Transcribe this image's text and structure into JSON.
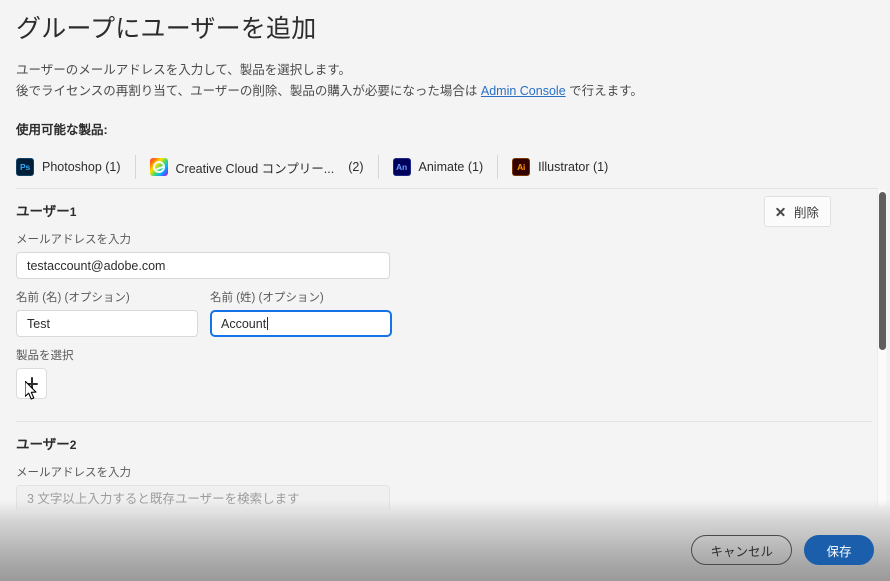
{
  "header": {
    "title": "グループにユーザーを追加",
    "intro_line_1": "ユーザーのメールアドレスを入力して、製品を選択します。",
    "intro_line_2_before": "後でライセンスの再割り当て、ユーザーの削除、製品の購入が必要になった場合は",
    "admin_console_link": "Admin Console",
    "intro_line_2_after": "で行えます。"
  },
  "products": {
    "heading": "使用可能な製品:",
    "items": [
      {
        "icon": "photoshop-icon",
        "icon_text": "Ps",
        "name": "Photoshop (1)",
        "count": ""
      },
      {
        "icon": "creative-cloud-icon",
        "icon_text": "",
        "name": "Creative Cloud コンプリー...",
        "count": "(2)"
      },
      {
        "icon": "animate-icon",
        "icon_text": "An",
        "name": "Animate (1)",
        "count": ""
      },
      {
        "icon": "illustrator-icon",
        "icon_text": "Ai",
        "name": "Illustrator (1)",
        "count": ""
      }
    ]
  },
  "users": [
    {
      "heading_label": "ユーザー",
      "heading_number": "1",
      "delete_label": "削除",
      "email_label": "メールアドレスを入力",
      "email_value": "testaccount@adobe.com",
      "first_name_label": "名前 (名) (オプション)",
      "first_name_value": "Test",
      "last_name_label": "名前 (姓) (オプション)",
      "last_name_value": "Account",
      "product_select_label": "製品を選択",
      "add_product_icon": "plus-icon"
    },
    {
      "heading_label": "ユーザー",
      "heading_number": "2",
      "email_label": "メールアドレスを入力",
      "email_placeholder": "3 文字以上入力すると既存ユーザーを検索します"
    }
  ],
  "footer": {
    "cancel_label": "キャンセル",
    "save_label": "保存"
  },
  "colors": {
    "accent_blue": "#1473e6",
    "save_blue": "#1b5fac",
    "link_blue": "#2a6fc4",
    "page_bg": "#f4f4f4"
  }
}
